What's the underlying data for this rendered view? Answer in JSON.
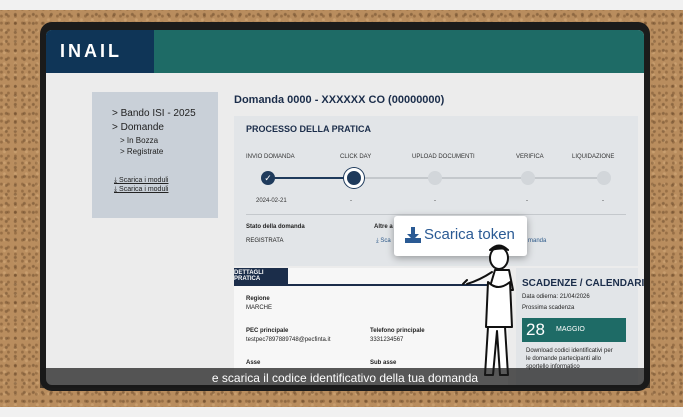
{
  "header": {
    "logo": "INAIL"
  },
  "sidebar": {
    "items": [
      "> Bando ISI - 2025",
      "> Domande"
    ],
    "subitems": [
      "> In Bozza",
      "> Registrate"
    ],
    "links": [
      "Scarica i moduli",
      "Scarica i moduli"
    ]
  },
  "main": {
    "title": "Domanda 0000 - XXXXXX CO (00000000)"
  },
  "process": {
    "title": "PROCESSO DELLA PRATICA",
    "steps": [
      {
        "label": "INVIO DOMANDA",
        "date": "2024-02-21",
        "status": "done"
      },
      {
        "label": "CLICK DAY",
        "date": "-",
        "status": "current"
      },
      {
        "label": "UPLOAD DOCUMENTI",
        "date": "-",
        "status": "pending"
      },
      {
        "label": "VERIFICA",
        "date": "-",
        "status": "pending"
      },
      {
        "label": "LIQUIDAZIONE",
        "date": "-",
        "status": "pending"
      }
    ],
    "stato_label": "Stato della domanda",
    "stato_value": "REGISTRATA",
    "altre_label": "Altre a",
    "altre_link": "Sca",
    "domanda_fragment": "manda"
  },
  "popup": {
    "label": "Scarica token"
  },
  "details": {
    "tab": "DETTAGLI PRATICA",
    "regione_label": "Regione",
    "regione_value": "MARCHE",
    "pec_label": "PEC principale",
    "pec_value": "testpec7897889748@pecfinta.it",
    "tel_label": "Telefono principale",
    "tel_value": "3331234567",
    "asse_label": "Asse",
    "subasse_label": "Sub asse"
  },
  "scadenze": {
    "title": "SCADENZE / CALENDARIO",
    "oggi_label": "Data odierna:",
    "oggi_value": "21/04/2026",
    "prossima": "Prossima scadenza",
    "day": "28",
    "month": "MAGGIO",
    "desc1": "Download codici identificativi per",
    "desc2": "le domande partecipanti allo",
    "desc3": "sportello informatico"
  },
  "subtitle": "e scarica il codice identificativo della tua domanda",
  "colors": {
    "header": "#1e6b66",
    "logo_bg": "#0f3557",
    "accent": "#1f3b5c",
    "link": "#2a5a94"
  }
}
